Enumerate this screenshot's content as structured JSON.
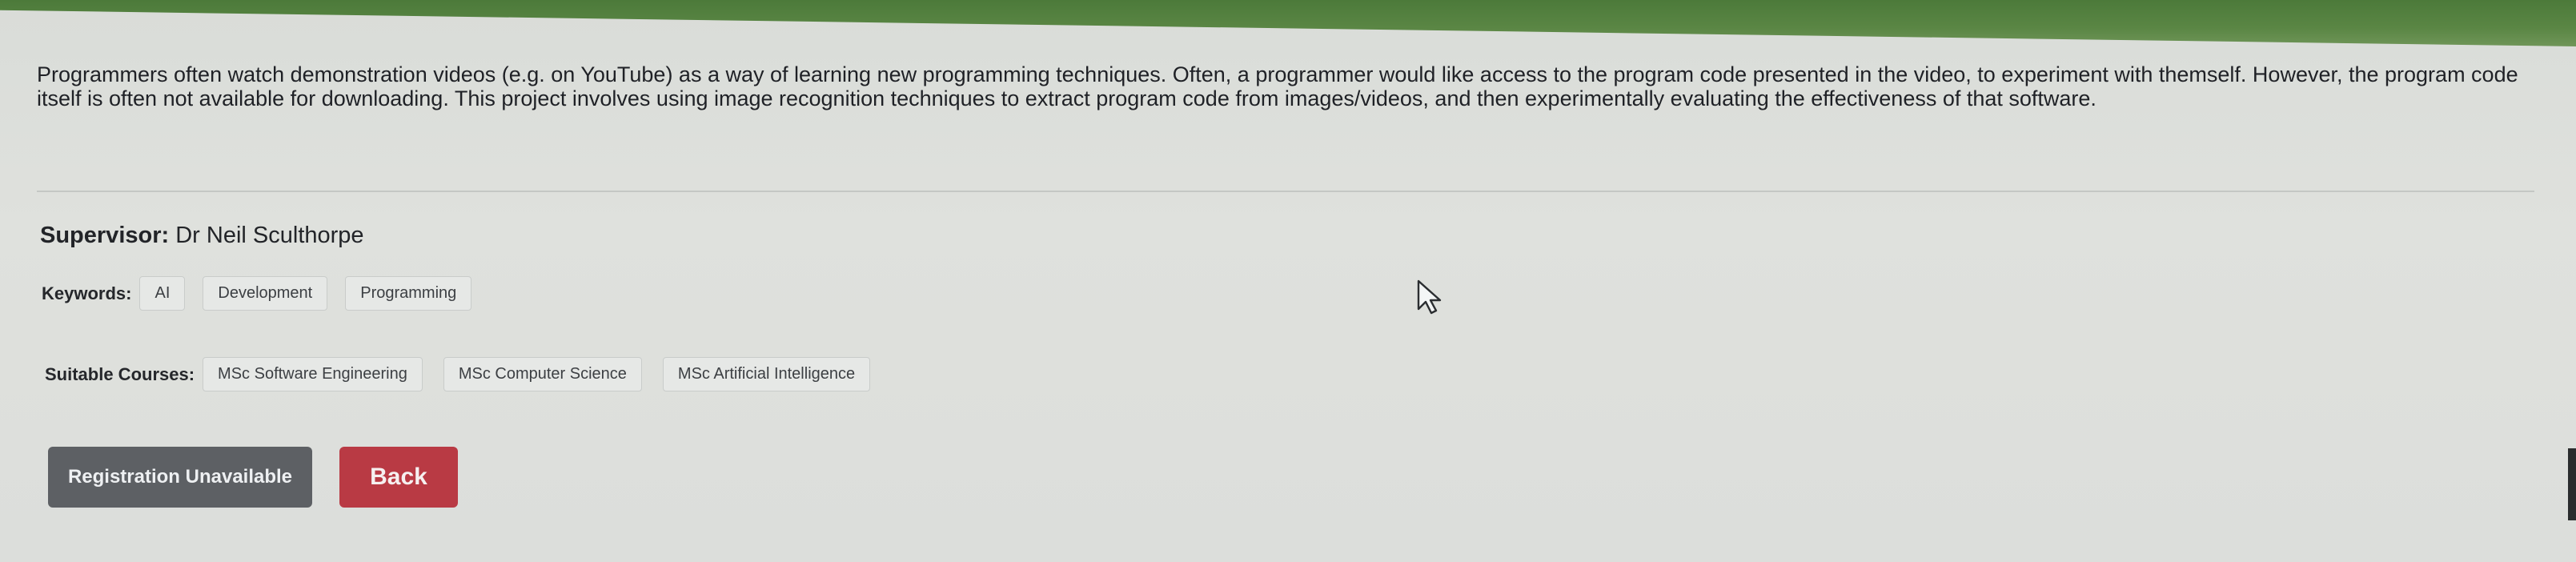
{
  "project": {
    "description": "Programmers often watch demonstration videos (e.g. on YouTube) as a way of learning new programming techniques. Often, a programmer would like access to the program code presented in the video, to experiment with themself. However, the program code itself is often not available for downloading. This project involves using image recognition techniques to extract program code from images/videos, and then experimentally evaluating the effectiveness of that software.",
    "supervisor_label": "Supervisor:",
    "supervisor_name": "Dr Neil Sculthorpe",
    "keywords_label": "Keywords:",
    "keywords": [
      "AI",
      "Development",
      "Programming"
    ],
    "courses_label": "Suitable Courses:",
    "courses": [
      "MSc Software Engineering",
      "MSc Computer Science",
      "MSc Artificial Intelligence"
    ]
  },
  "actions": {
    "registration_label": "Registration Unavailable",
    "back_label": "Back"
  },
  "colors": {
    "header_green": "#5a8644",
    "back_button": "#b93a44",
    "registration_button": "#5d6064"
  },
  "icons": {
    "cursor": "mouse-pointer-icon"
  }
}
